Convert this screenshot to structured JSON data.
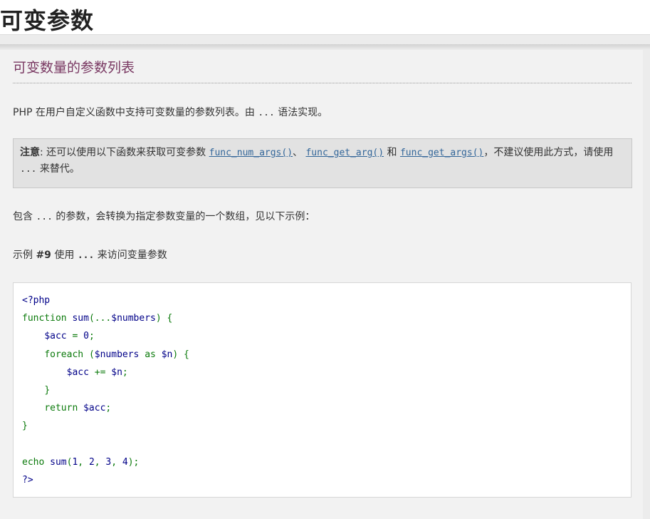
{
  "page": {
    "title": "可变参数"
  },
  "section": {
    "heading": "可变数量的参数列表"
  },
  "intro": {
    "before": "PHP 在用户自定义函数中支持可变数量的参数列表。由 ",
    "code": "...",
    "after": " 语法实现。"
  },
  "note": {
    "label": "注意",
    "t1": ": 还可以使用以下函数来获取可变参数 ",
    "link1": "func_num_args()",
    "t2": "、 ",
    "link2": "func_get_arg()",
    "t3": " 和 ",
    "link3": "func_get_args()",
    "t4": "，不建议使用此方式，请使用 ",
    "code": "...",
    "t5": " 来替代。"
  },
  "para2": {
    "before": "包含 ",
    "code": "...",
    "after": " 的参数，会转换为指定参数变量的一个数组，见以下示例："
  },
  "example": {
    "prefix": "示例 ",
    "number": "#9",
    "middle": " 使用 ",
    "code": "...",
    "suffix": " 来访问变量参数"
  },
  "code_lines": [
    "<?php",
    "function sum(...$numbers) {",
    "    $acc = 0;",
    "    foreach ($numbers as $n) {",
    "        $acc += $n;",
    "    }",
    "    return $acc;",
    "}",
    "",
    "echo sum(1, 2, 3, 4);",
    "?>"
  ],
  "colors": {
    "heading": "#793862",
    "link": "#336699",
    "code_green": "#0b7a0b",
    "code_blue": "#000088"
  }
}
